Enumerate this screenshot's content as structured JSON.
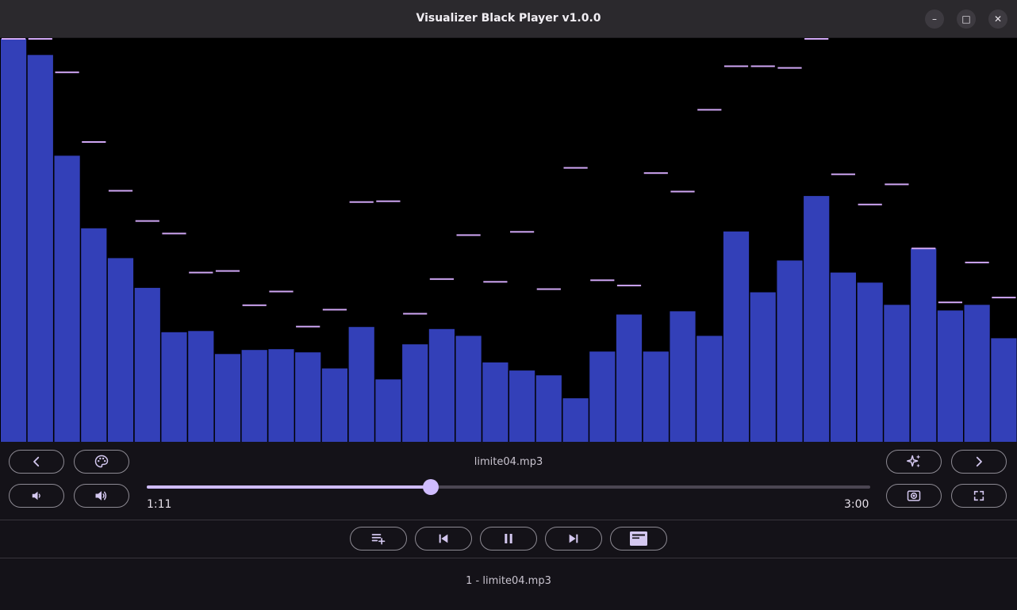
{
  "window": {
    "title": "Visualizer Black Player v1.0.0",
    "minimize_glyph": "–",
    "maximize_glyph": "□",
    "close_glyph": "✕"
  },
  "visualizer": {
    "bar_color": "#3340b8",
    "peak_color": "#cfa6f4",
    "bars": [
      {
        "level": 1.0,
        "peak": 1.0
      },
      {
        "level": 0.96,
        "peak": 1.0
      },
      {
        "level": 0.71,
        "peak": 0.917
      },
      {
        "level": 0.53,
        "peak": 0.744
      },
      {
        "level": 0.456,
        "peak": 0.623
      },
      {
        "level": 0.382,
        "peak": 0.548
      },
      {
        "level": 0.272,
        "peak": 0.517
      },
      {
        "level": 0.275,
        "peak": 0.42
      },
      {
        "level": 0.218,
        "peak": 0.424
      },
      {
        "level": 0.228,
        "peak": 0.339
      },
      {
        "level": 0.23,
        "peak": 0.373
      },
      {
        "level": 0.222,
        "peak": 0.286
      },
      {
        "level": 0.182,
        "peak": 0.328
      },
      {
        "level": 0.285,
        "peak": 0.595
      },
      {
        "level": 0.155,
        "peak": 0.597
      },
      {
        "level": 0.242,
        "peak": 0.318
      },
      {
        "level": 0.28,
        "peak": 0.404
      },
      {
        "level": 0.263,
        "peak": 0.513
      },
      {
        "level": 0.197,
        "peak": 0.397
      },
      {
        "level": 0.177,
        "peak": 0.521
      },
      {
        "level": 0.165,
        "peak": 0.379
      },
      {
        "level": 0.108,
        "peak": 0.68
      },
      {
        "level": 0.224,
        "peak": 0.401
      },
      {
        "level": 0.316,
        "peak": 0.388
      },
      {
        "level": 0.224,
        "peak": 0.667
      },
      {
        "level": 0.324,
        "peak": 0.621
      },
      {
        "level": 0.263,
        "peak": 0.824
      },
      {
        "level": 0.522,
        "peak": 0.932
      },
      {
        "level": 0.371,
        "peak": 0.932
      },
      {
        "level": 0.45,
        "peak": 0.928
      },
      {
        "level": 0.61,
        "peak": 1.0
      },
      {
        "level": 0.42,
        "peak": 0.664
      },
      {
        "level": 0.395,
        "peak": 0.589
      },
      {
        "level": 0.34,
        "peak": 0.639
      },
      {
        "level": 0.48,
        "peak": 0.48
      },
      {
        "level": 0.326,
        "peak": 0.346
      },
      {
        "level": 0.34,
        "peak": 0.445
      },
      {
        "level": 0.257,
        "peak": 0.358
      }
    ]
  },
  "player": {
    "filename": "limite04.mp3",
    "elapsed": "1:11",
    "duration": "3:00",
    "progress": 0.392
  },
  "playlist": {
    "items": [
      "1 - limite04.mp3"
    ]
  },
  "icons": {
    "prev_visualizer": "chevron-left-icon",
    "theme": "palette-icon",
    "volume_down": "volume-down-icon",
    "volume_up": "volume-up-icon",
    "effects": "sparkle-icon",
    "next_visualizer": "chevron-right-icon",
    "screen": "screen-record-icon",
    "fullscreen": "fullscreen-icon",
    "add_to_playlist": "playlist-add-icon",
    "previous_track": "skip-previous-icon",
    "pause": "pause-icon",
    "next_track": "skip-next-icon",
    "toggle_panel": "panel-icon"
  }
}
